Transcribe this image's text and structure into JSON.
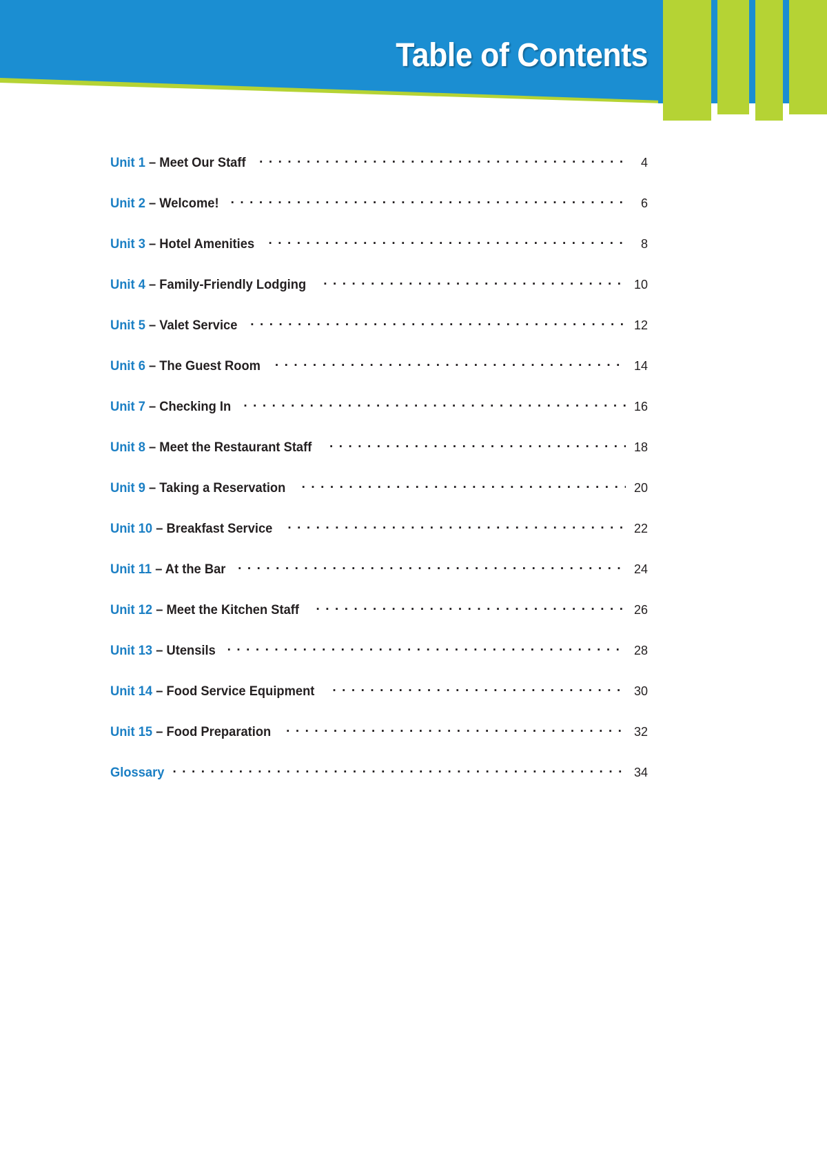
{
  "header": {
    "title": "Table of Contents",
    "colors": {
      "blue": "#1b8ed2",
      "green": "#b5d334",
      "title_text": "#ffffff"
    }
  },
  "toc": {
    "entry_color_unit": "#1b7fc4",
    "entry_color_title": "#231f20",
    "entries": [
      {
        "unit": "Unit 1",
        "title": "– Meet Our Staff",
        "page": "4"
      },
      {
        "unit": "Unit 2",
        "title": "– Welcome!",
        "page": "6"
      },
      {
        "unit": "Unit 3",
        "title": "– Hotel Amenities",
        "page": "8"
      },
      {
        "unit": "Unit 4",
        "title": "– Family-Friendly Lodging",
        "page": "10"
      },
      {
        "unit": "Unit 5",
        "title": "– Valet Service",
        "page": "12"
      },
      {
        "unit": "Unit 6",
        "title": "– The Guest Room",
        "page": "14"
      },
      {
        "unit": "Unit 7",
        "title": "– Checking In",
        "page": "16"
      },
      {
        "unit": "Unit 8",
        "title": "– Meet the Restaurant Staff",
        "page": "18"
      },
      {
        "unit": "Unit 9",
        "title": "– Taking a Reservation",
        "page": "20"
      },
      {
        "unit": "Unit 10",
        "title": "– Breakfast Service",
        "page": "22"
      },
      {
        "unit": "Unit 11",
        "title": "– At the Bar",
        "page": "24"
      },
      {
        "unit": "Unit 12",
        "title": "– Meet the Kitchen Staff",
        "page": "26"
      },
      {
        "unit": "Unit 13",
        "title": "– Utensils",
        "page": "28"
      },
      {
        "unit": "Unit 14",
        "title": "– Food Service Equipment",
        "page": "30"
      },
      {
        "unit": "Unit 15",
        "title": "– Food Preparation",
        "page": "32"
      },
      {
        "unit": "Glossary",
        "title": "",
        "page": "34"
      }
    ]
  }
}
